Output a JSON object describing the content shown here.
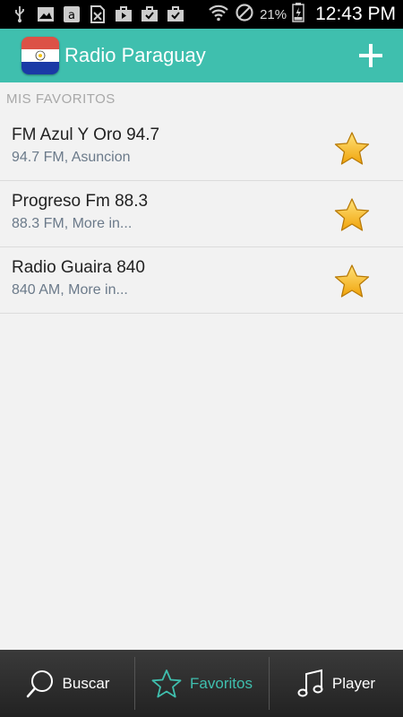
{
  "status": {
    "battery_pct": "21%",
    "time": "12:43 PM",
    "icons": [
      "usb-icon",
      "image-icon",
      "amazon-icon",
      "no-sim-icon",
      "briefcase-play-icon",
      "briefcase-check-icon",
      "briefcase-check-icon",
      "wifi-icon",
      "do-not-disturb-icon",
      "battery-icon"
    ]
  },
  "header": {
    "title": "Radio Paraguay",
    "add_icon": "plus-icon",
    "color": "#3fbfae"
  },
  "favorites": {
    "section_title": "MIS FAVORITOS",
    "items": [
      {
        "name": "FM Azul Y Oro 94.7",
        "subtitle": "94.7 FM, Asuncion"
      },
      {
        "name": "Progreso Fm 88.3",
        "subtitle": "88.3 FM, More in..."
      },
      {
        "name": "Radio Guaira 840",
        "subtitle": "840 AM, More in..."
      }
    ]
  },
  "nav": {
    "items": [
      {
        "label": "Buscar",
        "icon": "search-icon"
      },
      {
        "label": "Favoritos",
        "icon": "star-outline-icon",
        "active": true
      },
      {
        "label": "Player",
        "icon": "music-note-icon"
      }
    ]
  }
}
